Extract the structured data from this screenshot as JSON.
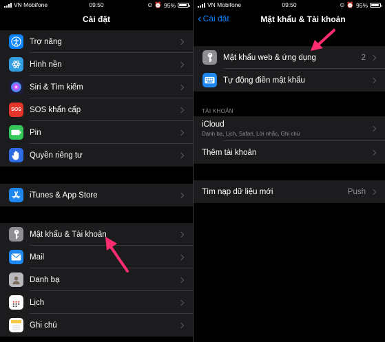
{
  "status": {
    "carrier": "VN Mobifone",
    "time": "09:50",
    "battery": "95%",
    "battery_level": 0.95
  },
  "left": {
    "title": "Cài đặt",
    "group1": [
      {
        "label": "Trợ năng",
        "icon": "accessibility-icon",
        "color": "#0a84ff"
      },
      {
        "label": "Hình nền",
        "icon": "wallpaper-icon",
        "color": "#32a0e0"
      },
      {
        "label": "Siri & Tìm kiếm",
        "icon": "siri-icon",
        "color": "#1c1c3a"
      },
      {
        "label": "SOS khẩn cấp",
        "icon": "sos-icon",
        "color": "#e5342b",
        "glyph": "SOS"
      },
      {
        "label": "Pin",
        "icon": "battery-icon",
        "color": "#34c759"
      },
      {
        "label": "Quyền riêng tư",
        "icon": "hand-icon",
        "color": "#2f6be0"
      }
    ],
    "group2": [
      {
        "label": "iTunes & App Store",
        "icon": "app-store-icon",
        "color": "#1e88f0"
      }
    ],
    "group3": [
      {
        "label": "Mật khẩu & Tài khoản",
        "icon": "key-icon",
        "color": "#8e8e93"
      },
      {
        "label": "Mail",
        "icon": "mail-icon",
        "color": "#1e88f0"
      },
      {
        "label": "Danh bạ",
        "icon": "contacts-icon",
        "color": "#b8b8bd"
      },
      {
        "label": "Lịch",
        "icon": "calendar-icon",
        "color": "#ffffff"
      },
      {
        "label": "Ghi chú",
        "icon": "notes-icon",
        "color": "#ffffff"
      }
    ]
  },
  "right": {
    "back_label": "Cài đặt",
    "title": "Mật khẩu & Tài khoản",
    "passwords": [
      {
        "label": "Mật khẩu web & ứng dụng",
        "value": "2",
        "icon": "key-icon",
        "color": "#8e8e93"
      },
      {
        "label": "Tự động điền mật khẩu",
        "value": "",
        "icon": "keyboard-icon",
        "color": "#1e88f0"
      }
    ],
    "accounts_header": "TÀI KHOẢN",
    "accounts": [
      {
        "label": "iCloud",
        "sub": "Danh bạ, Lịch, Safari, Lời nhắc, Ghi chú"
      },
      {
        "label": "Thêm tài khoản",
        "sub": ""
      }
    ],
    "fetch": {
      "label": "Tìm nạp dữ liệu mới",
      "value": "Push"
    }
  },
  "colors": {
    "accent": "#0a84ff",
    "arrow": "#ff2d6f"
  }
}
